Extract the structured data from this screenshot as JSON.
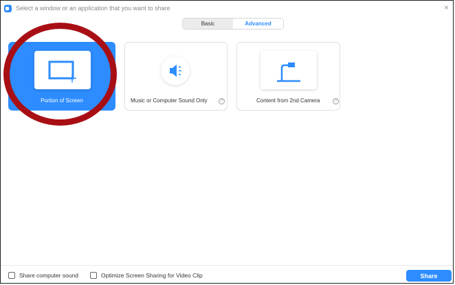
{
  "window": {
    "title": "Select a window or an application that you want to share",
    "close_glyph": "×"
  },
  "tabs": [
    {
      "label": "Basic",
      "selected": false
    },
    {
      "label": "Advanced",
      "selected": true
    }
  ],
  "options": [
    {
      "label": "Portion of Screen",
      "icon": "screen-portion-icon",
      "selected": true,
      "has_help": false
    },
    {
      "label": "Music or Computer Sound Only",
      "icon": "speaker-icon",
      "selected": false,
      "has_help": true
    },
    {
      "label": "Content from 2nd Camera",
      "icon": "document-camera-icon",
      "selected": false,
      "has_help": true
    }
  ],
  "footer": {
    "share_sound_label": "Share computer sound",
    "share_sound_checked": false,
    "optimize_label": "Optimize Screen Sharing for Video Clip",
    "optimize_checked": false,
    "share_button_label": "Share"
  },
  "help_glyph": "?",
  "colors": {
    "accent": "#2d8cff",
    "annotation_circle": "#a80f14"
  }
}
